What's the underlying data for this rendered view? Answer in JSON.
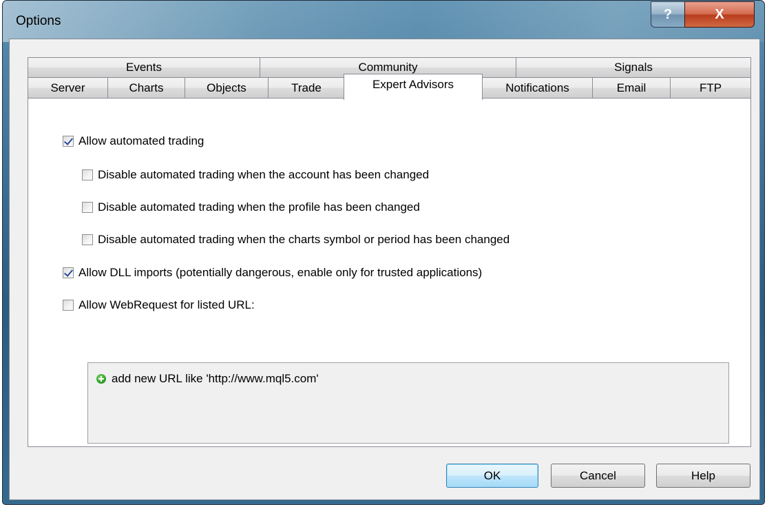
{
  "window": {
    "title": "Options",
    "help_glyph": "?",
    "close_glyph": "X"
  },
  "tabs": {
    "row1": [
      "Events",
      "Community",
      "Signals"
    ],
    "row2": [
      "Server",
      "Charts",
      "Objects",
      "Trade",
      "Expert Advisors",
      "Notifications",
      "Email",
      "FTP"
    ],
    "active": "Expert Advisors"
  },
  "options": {
    "allow_automated": {
      "label": "Allow automated trading",
      "checked": true
    },
    "disable_account": {
      "label": "Disable automated trading when the account has been changed",
      "checked": false
    },
    "disable_profile": {
      "label": "Disable automated trading when the profile has been changed",
      "checked": false
    },
    "disable_symbol": {
      "label": "Disable automated trading when the charts symbol or period has been changed",
      "checked": false
    },
    "allow_dll": {
      "label": "Allow DLL imports (potentially dangerous, enable only for trusted applications)",
      "checked": true
    },
    "allow_webrequest": {
      "label": "Allow WebRequest for listed URL:",
      "checked": false
    }
  },
  "url_list": {
    "add_item": "add new URL like 'http://www.mql5.com'",
    "icon": "plus-circle-icon"
  },
  "buttons": {
    "ok": "OK",
    "cancel": "Cancel",
    "help": "Help"
  },
  "colors": {
    "title_bar": "#3f7498",
    "close_button": "#c7472a",
    "checkmark": "#2a4a9c",
    "add_icon": "#33a12a",
    "default_button_border": "#3c7fb1"
  }
}
